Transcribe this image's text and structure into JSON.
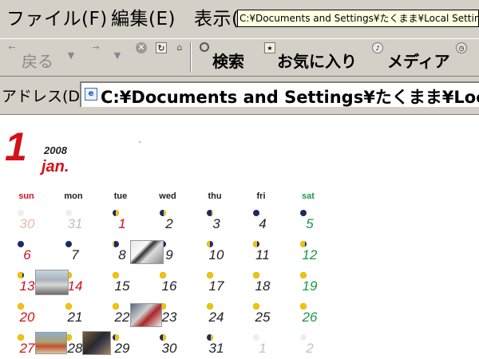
{
  "menu": {
    "file": "ファイル(F)",
    "edit": "編集(E)",
    "view": "表示(",
    "tooltip": "C:¥Documents and Settings¥たくまま¥Local Settings¥"
  },
  "toolbar": {
    "back": "戻る",
    "search": "検索",
    "favorites": "お気に入り",
    "media": "メディア"
  },
  "address": {
    "label": "アドレス(D)",
    "value": "C:¥Documents and Settings¥たくまま¥Local Settings¥"
  },
  "calendar": {
    "month_number": "1",
    "year": "2008",
    "month_name": "jan.",
    "weekdays": [
      "sun",
      "mon",
      "tue",
      "wed",
      "thu",
      "fri",
      "sat"
    ],
    "weeks": [
      [
        "30",
        "31",
        "1",
        "2",
        "3",
        "4",
        "5"
      ],
      [
        "6",
        "7",
        "8",
        "9",
        "10",
        "11",
        "12"
      ],
      [
        "13",
        "14",
        "15",
        "16",
        "17",
        "18",
        "19"
      ],
      [
        "20",
        "21",
        "22",
        "23",
        "24",
        "25",
        "26"
      ],
      [
        "27",
        "28",
        "29",
        "30",
        "31",
        "1",
        "2"
      ]
    ],
    "colors": {
      "sunday": "#d4101a",
      "saturday": "#1a9a4a",
      "moon_dark": "#1c2a6a",
      "moon_lit": "#f2c400"
    }
  }
}
